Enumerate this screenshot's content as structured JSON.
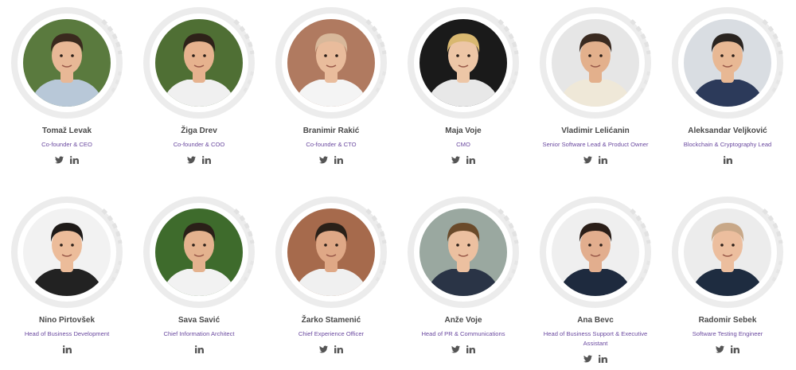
{
  "members": [
    {
      "name": "Tomaž Levak",
      "role": "Co-founder & CEO",
      "socials": [
        "twitter",
        "linkedin"
      ],
      "bg": "#5a7a3e",
      "hair": "#3a2a1e",
      "shirt": "#b8c8d8",
      "skin": "#e8b896"
    },
    {
      "name": "Žiga Drev",
      "role": "Co-founder & COO",
      "socials": [
        "twitter",
        "linkedin"
      ],
      "bg": "#4f6f34",
      "hair": "#2e2219",
      "shirt": "#f0f0f0",
      "skin": "#e6b28e"
    },
    {
      "name": "Branimir Rakić",
      "role": "Co-founder & CTO",
      "socials": [
        "twitter",
        "linkedin"
      ],
      "bg": "#b07a60",
      "hair": "#d8b89a",
      "shirt": "#f4f4f4",
      "skin": "#e9bc9c"
    },
    {
      "name": "Maja Voje",
      "role": "CMO",
      "socials": [
        "twitter",
        "linkedin"
      ],
      "bg": "#1a1a1a",
      "hair": "#d9b870",
      "shirt": "#e8e8e8",
      "skin": "#edc6a6"
    },
    {
      "name": "Vladimir Lelićanin",
      "role": "Senior Software Lead & Product Owner",
      "socials": [
        "twitter",
        "linkedin"
      ],
      "bg": "#e6e6e6",
      "hair": "#3a2a20",
      "shirt": "#efe8d8",
      "skin": "#e3b08c"
    },
    {
      "name": "Aleksandar Veljković",
      "role": "Blockchain & Cryptography Lead",
      "socials": [
        "linkedin"
      ],
      "bg": "#d9dde2",
      "hair": "#2a2420",
      "shirt": "#2c3a5a",
      "skin": "#e8b894"
    },
    {
      "name": "Nino Pirtovšek",
      "role": "Head of Business Development",
      "socials": [
        "linkedin"
      ],
      "bg": "#f2f2f2",
      "hair": "#1e1a18",
      "shirt": "#222222",
      "skin": "#ecbc9a"
    },
    {
      "name": "Sava Savić",
      "role": "Chief Information Architect",
      "socials": [
        "linkedin"
      ],
      "bg": "#3e6b2c",
      "hair": "#2a2018",
      "shirt": "#f2f2f2",
      "skin": "#e4b28e"
    },
    {
      "name": "Žarko Stamenić",
      "role": "Chief Experience Officer",
      "socials": [
        "twitter",
        "linkedin"
      ],
      "bg": "#a66a4c",
      "hair": "#2a2018",
      "shirt": "#f0f0f0",
      "skin": "#dfa886"
    },
    {
      "name": "Anže Voje",
      "role": "Head of PR & Communications",
      "socials": [
        "twitter",
        "linkedin"
      ],
      "bg": "#9aa8a0",
      "hair": "#6a4a2a",
      "shirt": "#2a3446",
      "skin": "#ecc0a0"
    },
    {
      "name": "Ana Bevc",
      "role": "Head of Business Support & Executive Assistant",
      "socials": [
        "twitter",
        "linkedin"
      ],
      "bg": "#efefef",
      "hair": "#2a1e18",
      "shirt": "#1e2a3e",
      "skin": "#e2ae8e"
    },
    {
      "name": "Radomir Sebek",
      "role": "Software Testing Engineer",
      "socials": [
        "twitter",
        "linkedin"
      ],
      "bg": "#ececec",
      "hair": "#c8a888",
      "shirt": "#1e2c40",
      "skin": "#ecbe9e"
    }
  ]
}
